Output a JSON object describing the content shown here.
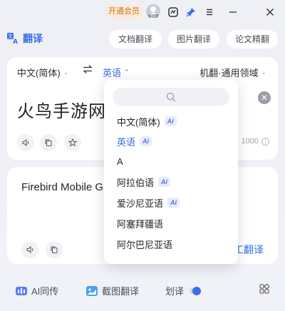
{
  "titlebar": {
    "vip_label": "开通会员",
    "avatar_tag": "登录"
  },
  "header": {
    "brand_label": "翻译",
    "buttons": [
      "文档翻译",
      "图片翻译",
      "论文精翻"
    ]
  },
  "input": {
    "source_lang": "中文(简体)",
    "target_lang": "英语",
    "engine_label": "机翻·通用领域",
    "source_text": "火鸟手游网",
    "char_limit": "1000"
  },
  "output": {
    "result_text": "Firebird Mobile G",
    "human_translate_label": "工翻译"
  },
  "dropdown": {
    "search_placeholder": "",
    "ai_badge": "Ai",
    "items": [
      {
        "label": "中文(简体)",
        "ai": true,
        "active": false
      },
      {
        "label": "英语",
        "ai": true,
        "active": true
      },
      {
        "label": "A",
        "ai": false,
        "active": false
      },
      {
        "label": "阿拉伯语",
        "ai": true,
        "active": false
      },
      {
        "label": "爱沙尼亚语",
        "ai": true,
        "active": false
      },
      {
        "label": "阿塞拜疆语",
        "ai": false,
        "active": false
      },
      {
        "label": "阿尔巴尼亚语",
        "ai": false,
        "active": false
      }
    ]
  },
  "bottom": {
    "ai_simul_label": "AI同传",
    "screenshot_label": "截图翻译",
    "select_translate_label": "划译"
  },
  "colors": {
    "accent": "#3a6ee8",
    "vip_bg": "#fde9d6",
    "vip_text": "#c8782c"
  },
  "icons": {
    "brand": "translate-icon",
    "dropdown_search": "search-icon"
  }
}
